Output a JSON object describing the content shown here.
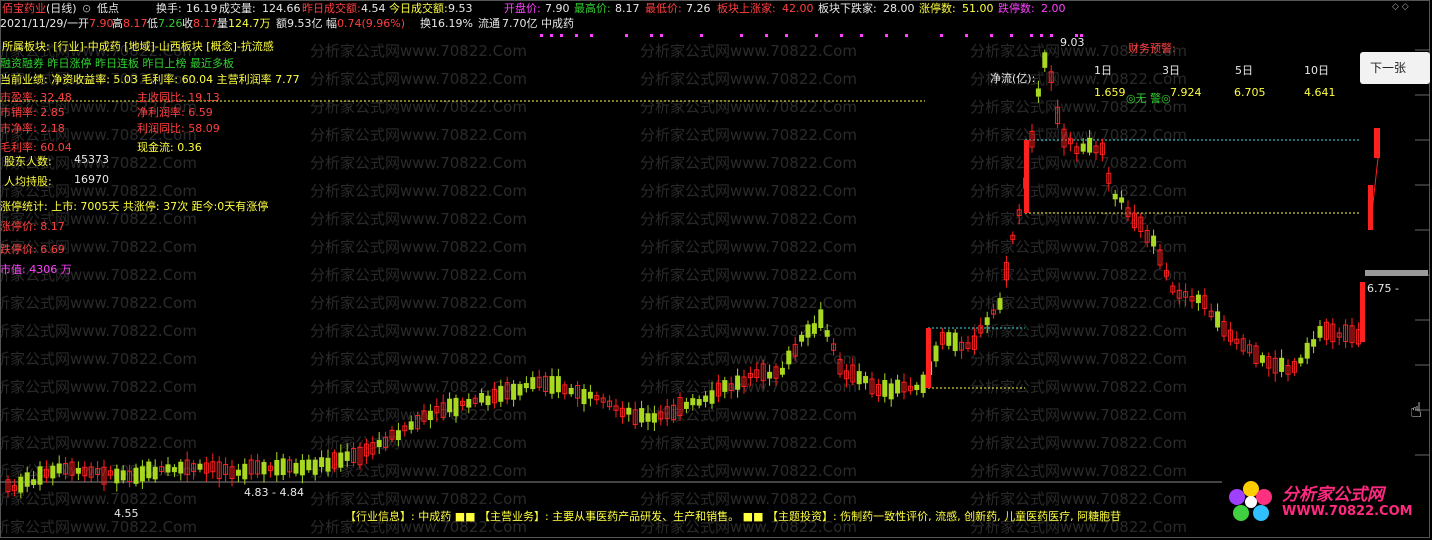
{
  "topbar": {
    "title": "佰宝药业",
    "period": "(日线)",
    "dropdown_icon": "chevron-down-icon",
    "mode": "低点",
    "turnover_label": "换手:",
    "turnover_value": "16.19",
    "volume_label": "成交量:",
    "volume_value": "124.66",
    "yest_amount_label": "昨日成交额:",
    "yest_amount_value": "4.54",
    "today_amount_label": "今日成交额:",
    "today_amount_value": "9.53",
    "open_label": "开盘价:",
    "open_value": "7.90",
    "high_label": "最高价:",
    "high_value": "8.17",
    "low_label": "最低价:",
    "low_value": "7.26",
    "sector_up_label": "板块上涨家:",
    "sector_up_value": "42.00",
    "sector_down_label": "板块下跌家:",
    "sector_down_value": "28.00",
    "limit_up_label": "涨停数:",
    "limit_up_value": "51.00",
    "limit_down_label": "跌停数:",
    "limit_down_value": "2.00"
  },
  "row2": {
    "date": "2021/11/29/一",
    "open_label": "开",
    "open_value": "7.90",
    "high_label": "高",
    "high_value": "8.17",
    "low_label": "低",
    "low_value": "7.26",
    "close_label": "收",
    "close_value": "8.17",
    "vol_label": "量",
    "vol_value": "124.7万",
    "amount_label": "额",
    "amount_value": "9.53亿",
    "pct_label": "幅",
    "pct_value": "0.74(9.96%)",
    "turn_label": "换",
    "turn_value": "16.19%",
    "float_label": "流通",
    "float_value": "7.70亿",
    "industry": "中成药"
  },
  "info": {
    "sector_line": "所属板块: [行业]-中成药 [地域]-山西板块 [概念]-抗流感",
    "tags_line": "融资融券 昨日涨停 昨日连板 昨日上榜 最近多板",
    "perf_line": "当前业绩: 净资收益率: 5.03 毛利率: 60.04 主营利润率 7.77",
    "pe": "市盈率: 32.48",
    "ps": "市销率: 2.85",
    "pb": "市净率: 2.18",
    "gross": "毛利率: 60.04",
    "rev_yoy": "主收同比: 19.13",
    "net_margin": "净利润率: 6.59",
    "profit_yoy": "利润同比: 58.09",
    "cash_flow": "现金流: 0.36",
    "holders_label": "股东人数:",
    "holders_value": "45373",
    "per_holder_label": "人均持股:",
    "per_holder_value": "16970",
    "limit_stats": "涨停统计:  上市: 7005天   共涨停: 37次   距今:0天有涨停",
    "limit_up_price": "涨停价: 8.17",
    "limit_down_price": "跌停价: 6.69",
    "cap": "市值: 4306 万"
  },
  "netflow": {
    "label": "净流(亿):",
    "periods": [
      "1日",
      "3日",
      "5日",
      "10日"
    ],
    "values": [
      "1.659",
      "7.924",
      "6.705",
      "4.641"
    ],
    "warning_title": "财务预警:",
    "warning_value": "无 警"
  },
  "chart": {
    "high_label": "9.03",
    "low_label": "4.55",
    "range_label": "4.83 - 4.84",
    "right_label": "6.75 -",
    "up_color": "#ff2020",
    "down_color": "#a8d820"
  },
  "next_button": "下一张",
  "bottom": {
    "text": "【行业信息】: 中成药  ■■  【主营业务】: 主要从事医药产品研发、生产和销售。  ■■  【主题投资】: 伤制药一致性评价, 流感, 创新药, 儿童医药医疗, 阿糖胞苷"
  },
  "logo": {
    "line1": "分析家公式网",
    "line2": "WWW.70822.COM"
  },
  "watermark": "分析家公式网www.70822.Com"
}
